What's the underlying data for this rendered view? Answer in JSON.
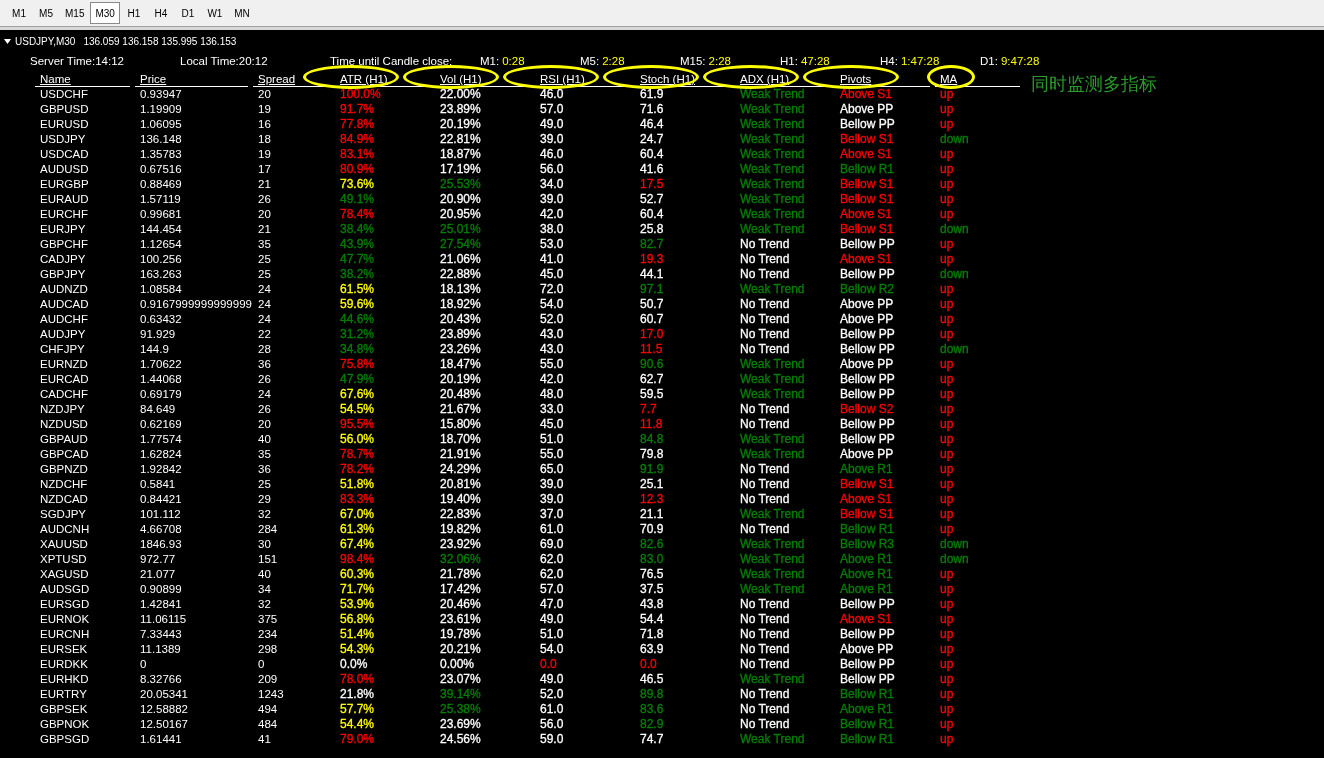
{
  "timeframes": [
    {
      "label": "M1",
      "selected": false
    },
    {
      "label": "M5",
      "selected": false
    },
    {
      "label": "M15",
      "selected": false
    },
    {
      "label": "M30",
      "selected": true
    },
    {
      "label": "H1",
      "selected": false
    },
    {
      "label": "H4",
      "selected": false
    },
    {
      "label": "D1",
      "selected": false
    },
    {
      "label": "W1",
      "selected": false
    },
    {
      "label": "MN",
      "selected": false
    }
  ],
  "chart_title": {
    "symbol": "USDJPY,M30",
    "quotes": "136.059 136.158 135.995 136.153"
  },
  "info": {
    "server_time": "Server Time:14:12",
    "local_time": "Local Time:20:12",
    "countdown_label": "Time until Candle close:",
    "countdowns": [
      {
        "label": "M1:",
        "value": "0:28"
      },
      {
        "label": "M5:",
        "value": "2:28"
      },
      {
        "label": "M15:",
        "value": "2:28"
      },
      {
        "label": "H1:",
        "value": "47:28"
      },
      {
        "label": "H4:",
        "value": "1:47:28"
      },
      {
        "label": "D1:",
        "value": "9:47:28"
      }
    ]
  },
  "columns": [
    {
      "label": "Name",
      "circled": false
    },
    {
      "label": "Price",
      "circled": false
    },
    {
      "label": "Spread",
      "circled": false
    },
    {
      "label": "ATR (H1)",
      "circled": true
    },
    {
      "label": "Vol (H1)",
      "circled": true
    },
    {
      "label": "RSI (H1)",
      "circled": true
    },
    {
      "label": "Stoch (H1)",
      "circled": true
    },
    {
      "label": "ADX (H1)",
      "circled": true
    },
    {
      "label": "Pivots",
      "circled": true
    },
    {
      "label": "MA",
      "circled": true
    }
  ],
  "annotation": "同时监测多指标",
  "rows": [
    {
      "symbol": "USDCHF",
      "price": "0.93947",
      "spread": "20",
      "cells": [
        {
          "text": "100.0%",
          "color": "#ff0000"
        },
        {
          "text": "22.00%",
          "color": "#ffffff"
        },
        {
          "text": "46.0",
          "color": "#ffffff"
        },
        {
          "text": "61.9",
          "color": "#ffffff"
        },
        {
          "text": "Weak Trend",
          "color": "#008000"
        },
        {
          "text": "Above S1",
          "color": "#ff0000"
        },
        {
          "text": "up",
          "color": "#ff0000"
        }
      ]
    },
    {
      "symbol": "GBPUSD",
      "price": "1.19909",
      "spread": "19",
      "cells": [
        {
          "text": "91.7%",
          "color": "#ff0000"
        },
        {
          "text": "23.89%",
          "color": "#ffffff"
        },
        {
          "text": "57.0",
          "color": "#ffffff"
        },
        {
          "text": "71.6",
          "color": "#ffffff"
        },
        {
          "text": "Weak Trend",
          "color": "#008000"
        },
        {
          "text": "Above PP",
          "color": "#ffffff"
        },
        {
          "text": "up",
          "color": "#ff0000"
        }
      ]
    },
    {
      "symbol": "EURUSD",
      "price": "1.06095",
      "spread": "16",
      "cells": [
        {
          "text": "77.8%",
          "color": "#ff0000"
        },
        {
          "text": "20.19%",
          "color": "#ffffff"
        },
        {
          "text": "49.0",
          "color": "#ffffff"
        },
        {
          "text": "46.4",
          "color": "#ffffff"
        },
        {
          "text": "Weak Trend",
          "color": "#008000"
        },
        {
          "text": "Bellow PP",
          "color": "#ffffff"
        },
        {
          "text": "up",
          "color": "#ff0000"
        }
      ]
    },
    {
      "symbol": "USDJPY",
      "price": "136.148",
      "spread": "18",
      "cells": [
        {
          "text": "84.9%",
          "color": "#ff0000"
        },
        {
          "text": "22.81%",
          "color": "#ffffff"
        },
        {
          "text": "39.0",
          "color": "#ffffff"
        },
        {
          "text": "24.7",
          "color": "#ffffff"
        },
        {
          "text": "Weak Trend",
          "color": "#008000"
        },
        {
          "text": "Bellow S1",
          "color": "#ff0000"
        },
        {
          "text": "down",
          "color": "#008000"
        }
      ]
    },
    {
      "symbol": "USDCAD",
      "price": "1.35783",
      "spread": "19",
      "cells": [
        {
          "text": "83.1%",
          "color": "#ff0000"
        },
        {
          "text": "18.87%",
          "color": "#ffffff"
        },
        {
          "text": "46.0",
          "color": "#ffffff"
        },
        {
          "text": "60.4",
          "color": "#ffffff"
        },
        {
          "text": "Weak Trend",
          "color": "#008000"
        },
        {
          "text": "Above S1",
          "color": "#ff0000"
        },
        {
          "text": "up",
          "color": "#ff0000"
        }
      ]
    },
    {
      "symbol": "AUDUSD",
      "price": "0.67516",
      "spread": "17",
      "cells": [
        {
          "text": "80.9%",
          "color": "#ff0000"
        },
        {
          "text": "17.19%",
          "color": "#ffffff"
        },
        {
          "text": "56.0",
          "color": "#ffffff"
        },
        {
          "text": "41.6",
          "color": "#ffffff"
        },
        {
          "text": "Weak Trend",
          "color": "#008000"
        },
        {
          "text": "Bellow R1",
          "color": "#008000"
        },
        {
          "text": "up",
          "color": "#ff0000"
        }
      ]
    },
    {
      "symbol": "EURGBP",
      "price": "0.88469",
      "spread": "21",
      "cells": [
        {
          "text": "73.6%",
          "color": "#ffff00"
        },
        {
          "text": "25.53%",
          "color": "#008000"
        },
        {
          "text": "34.0",
          "color": "#ffffff"
        },
        {
          "text": "17.5",
          "color": "#ff0000"
        },
        {
          "text": "Weak Trend",
          "color": "#008000"
        },
        {
          "text": "Bellow S1",
          "color": "#ff0000"
        },
        {
          "text": "up",
          "color": "#ff0000"
        }
      ]
    },
    {
      "symbol": "EURAUD",
      "price": "1.57119",
      "spread": "26",
      "cells": [
        {
          "text": "49.1%",
          "color": "#008000"
        },
        {
          "text": "20.90%",
          "color": "#ffffff"
        },
        {
          "text": "39.0",
          "color": "#ffffff"
        },
        {
          "text": "52.7",
          "color": "#ffffff"
        },
        {
          "text": "Weak Trend",
          "color": "#008000"
        },
        {
          "text": "Bellow S1",
          "color": "#ff0000"
        },
        {
          "text": "up",
          "color": "#ff0000"
        }
      ]
    },
    {
      "symbol": "EURCHF",
      "price": "0.99681",
      "spread": "20",
      "cells": [
        {
          "text": "78.4%",
          "color": "#ff0000"
        },
        {
          "text": "20.95%",
          "color": "#ffffff"
        },
        {
          "text": "42.0",
          "color": "#ffffff"
        },
        {
          "text": "60.4",
          "color": "#ffffff"
        },
        {
          "text": "Weak Trend",
          "color": "#008000"
        },
        {
          "text": "Above S1",
          "color": "#ff0000"
        },
        {
          "text": "up",
          "color": "#ff0000"
        }
      ]
    },
    {
      "symbol": "EURJPY",
      "price": "144.454",
      "spread": "21",
      "cells": [
        {
          "text": "38.4%",
          "color": "#008000"
        },
        {
          "text": "25.01%",
          "color": "#008000"
        },
        {
          "text": "38.0",
          "color": "#ffffff"
        },
        {
          "text": "25.8",
          "color": "#ffffff"
        },
        {
          "text": "Weak Trend",
          "color": "#008000"
        },
        {
          "text": "Bellow S1",
          "color": "#ff0000"
        },
        {
          "text": "down",
          "color": "#008000"
        }
      ]
    },
    {
      "symbol": "GBPCHF",
      "price": "1.12654",
      "spread": "35",
      "cells": [
        {
          "text": "43.9%",
          "color": "#008000"
        },
        {
          "text": "27.54%",
          "color": "#008000"
        },
        {
          "text": "53.0",
          "color": "#ffffff"
        },
        {
          "text": "82.7",
          "color": "#008000"
        },
        {
          "text": "No Trend",
          "color": "#ffffff"
        },
        {
          "text": "Bellow PP",
          "color": "#ffffff"
        },
        {
          "text": "up",
          "color": "#ff0000"
        }
      ]
    },
    {
      "symbol": "CADJPY",
      "price": "100.256",
      "spread": "25",
      "cells": [
        {
          "text": "47.7%",
          "color": "#008000"
        },
        {
          "text": "21.06%",
          "color": "#ffffff"
        },
        {
          "text": "41.0",
          "color": "#ffffff"
        },
        {
          "text": "19.3",
          "color": "#ff0000"
        },
        {
          "text": "No Trend",
          "color": "#ffffff"
        },
        {
          "text": "Above S1",
          "color": "#ff0000"
        },
        {
          "text": "up",
          "color": "#ff0000"
        }
      ]
    },
    {
      "symbol": "GBPJPY",
      "price": "163.263",
      "spread": "25",
      "cells": [
        {
          "text": "38.2%",
          "color": "#008000"
        },
        {
          "text": "22.88%",
          "color": "#ffffff"
        },
        {
          "text": "45.0",
          "color": "#ffffff"
        },
        {
          "text": "44.1",
          "color": "#ffffff"
        },
        {
          "text": "No Trend",
          "color": "#ffffff"
        },
        {
          "text": "Bellow PP",
          "color": "#ffffff"
        },
        {
          "text": "down",
          "color": "#008000"
        }
      ]
    },
    {
      "symbol": "AUDNZD",
      "price": "1.08584",
      "spread": "24",
      "cells": [
        {
          "text": "61.5%",
          "color": "#ffff00"
        },
        {
          "text": "18.13%",
          "color": "#ffffff"
        },
        {
          "text": "72.0",
          "color": "#ffffff"
        },
        {
          "text": "97.1",
          "color": "#008000"
        },
        {
          "text": "Weak Trend",
          "color": "#008000"
        },
        {
          "text": "Bellow R2",
          "color": "#008000"
        },
        {
          "text": "up",
          "color": "#ff0000"
        }
      ]
    },
    {
      "symbol": "AUDCAD",
      "price": "0.9167999999999999",
      "spread": "24",
      "cells": [
        {
          "text": "59.6%",
          "color": "#ffff00"
        },
        {
          "text": "18.92%",
          "color": "#ffffff"
        },
        {
          "text": "54.0",
          "color": "#ffffff"
        },
        {
          "text": "50.7",
          "color": "#ffffff"
        },
        {
          "text": "No Trend",
          "color": "#ffffff"
        },
        {
          "text": "Above PP",
          "color": "#ffffff"
        },
        {
          "text": "up",
          "color": "#ff0000"
        }
      ]
    },
    {
      "symbol": "AUDCHF",
      "price": "0.63432",
      "spread": "24",
      "cells": [
        {
          "text": "44.6%",
          "color": "#008000"
        },
        {
          "text": "20.43%",
          "color": "#ffffff"
        },
        {
          "text": "52.0",
          "color": "#ffffff"
        },
        {
          "text": "60.7",
          "color": "#ffffff"
        },
        {
          "text": "No Trend",
          "color": "#ffffff"
        },
        {
          "text": "Above PP",
          "color": "#ffffff"
        },
        {
          "text": "up",
          "color": "#ff0000"
        }
      ]
    },
    {
      "symbol": "AUDJPY",
      "price": "91.929",
      "spread": "22",
      "cells": [
        {
          "text": "31.2%",
          "color": "#008000"
        },
        {
          "text": "23.89%",
          "color": "#ffffff"
        },
        {
          "text": "43.0",
          "color": "#ffffff"
        },
        {
          "text": "17.0",
          "color": "#ff0000"
        },
        {
          "text": "No Trend",
          "color": "#ffffff"
        },
        {
          "text": "Bellow PP",
          "color": "#ffffff"
        },
        {
          "text": "up",
          "color": "#ff0000"
        }
      ]
    },
    {
      "symbol": "CHFJPY",
      "price": "144.9",
      "spread": "28",
      "cells": [
        {
          "text": "34.8%",
          "color": "#008000"
        },
        {
          "text": "23.26%",
          "color": "#ffffff"
        },
        {
          "text": "43.0",
          "color": "#ffffff"
        },
        {
          "text": "11.5",
          "color": "#ff0000"
        },
        {
          "text": "No Trend",
          "color": "#ffffff"
        },
        {
          "text": "Bellow PP",
          "color": "#ffffff"
        },
        {
          "text": "down",
          "color": "#008000"
        }
      ]
    },
    {
      "symbol": "EURNZD",
      "price": "1.70622",
      "spread": "36",
      "cells": [
        {
          "text": "75.8%",
          "color": "#ff0000"
        },
        {
          "text": "18.47%",
          "color": "#ffffff"
        },
        {
          "text": "55.0",
          "color": "#ffffff"
        },
        {
          "text": "90.6",
          "color": "#008000"
        },
        {
          "text": "Weak Trend",
          "color": "#008000"
        },
        {
          "text": "Above PP",
          "color": "#ffffff"
        },
        {
          "text": "up",
          "color": "#ff0000"
        }
      ]
    },
    {
      "symbol": "EURCAD",
      "price": "1.44068",
      "spread": "26",
      "cells": [
        {
          "text": "47.9%",
          "color": "#008000"
        },
        {
          "text": "20.19%",
          "color": "#ffffff"
        },
        {
          "text": "42.0",
          "color": "#ffffff"
        },
        {
          "text": "62.7",
          "color": "#ffffff"
        },
        {
          "text": "Weak Trend",
          "color": "#008000"
        },
        {
          "text": "Bellow PP",
          "color": "#ffffff"
        },
        {
          "text": "up",
          "color": "#ff0000"
        }
      ]
    },
    {
      "symbol": "CADCHF",
      "price": "0.69179",
      "spread": "24",
      "cells": [
        {
          "text": "67.6%",
          "color": "#ffff00"
        },
        {
          "text": "20.48%",
          "color": "#ffffff"
        },
        {
          "text": "48.0",
          "color": "#ffffff"
        },
        {
          "text": "59.5",
          "color": "#ffffff"
        },
        {
          "text": "Weak Trend",
          "color": "#008000"
        },
        {
          "text": "Bellow PP",
          "color": "#ffffff"
        },
        {
          "text": "up",
          "color": "#ff0000"
        }
      ]
    },
    {
      "symbol": "NZDJPY",
      "price": "84.649",
      "spread": "26",
      "cells": [
        {
          "text": "54.5%",
          "color": "#ffff00"
        },
        {
          "text": "21.67%",
          "color": "#ffffff"
        },
        {
          "text": "33.0",
          "color": "#ffffff"
        },
        {
          "text": "7.7",
          "color": "#ff0000"
        },
        {
          "text": "No Trend",
          "color": "#ffffff"
        },
        {
          "text": "Bellow S2",
          "color": "#ff0000"
        },
        {
          "text": "up",
          "color": "#ff0000"
        }
      ]
    },
    {
      "symbol": "NZDUSD",
      "price": "0.62169",
      "spread": "20",
      "cells": [
        {
          "text": "95.5%",
          "color": "#ff0000"
        },
        {
          "text": "15.80%",
          "color": "#ffffff"
        },
        {
          "text": "45.0",
          "color": "#ffffff"
        },
        {
          "text": "11.8",
          "color": "#ff0000"
        },
        {
          "text": "No Trend",
          "color": "#ffffff"
        },
        {
          "text": "Bellow PP",
          "color": "#ffffff"
        },
        {
          "text": "up",
          "color": "#ff0000"
        }
      ]
    },
    {
      "symbol": "GBPAUD",
      "price": "1.77574",
      "spread": "40",
      "cells": [
        {
          "text": "56.0%",
          "color": "#ffff00"
        },
        {
          "text": "18.70%",
          "color": "#ffffff"
        },
        {
          "text": "51.0",
          "color": "#ffffff"
        },
        {
          "text": "84.8",
          "color": "#008000"
        },
        {
          "text": "Weak Trend",
          "color": "#008000"
        },
        {
          "text": "Bellow PP",
          "color": "#ffffff"
        },
        {
          "text": "up",
          "color": "#ff0000"
        }
      ]
    },
    {
      "symbol": "GBPCAD",
      "price": "1.62824",
      "spread": "35",
      "cells": [
        {
          "text": "78.7%",
          "color": "#ff0000"
        },
        {
          "text": "21.91%",
          "color": "#ffffff"
        },
        {
          "text": "55.0",
          "color": "#ffffff"
        },
        {
          "text": "79.8",
          "color": "#ffffff"
        },
        {
          "text": "Weak Trend",
          "color": "#008000"
        },
        {
          "text": "Above PP",
          "color": "#ffffff"
        },
        {
          "text": "up",
          "color": "#ff0000"
        }
      ]
    },
    {
      "symbol": "GBPNZD",
      "price": "1.92842",
      "spread": "36",
      "cells": [
        {
          "text": "78.2%",
          "color": "#ff0000"
        },
        {
          "text": "24.29%",
          "color": "#ffffff"
        },
        {
          "text": "65.0",
          "color": "#ffffff"
        },
        {
          "text": "91.9",
          "color": "#008000"
        },
        {
          "text": "No Trend",
          "color": "#ffffff"
        },
        {
          "text": "Above R1",
          "color": "#008000"
        },
        {
          "text": "up",
          "color": "#ff0000"
        }
      ]
    },
    {
      "symbol": "NZDCHF",
      "price": "0.5841",
      "spread": "25",
      "cells": [
        {
          "text": "51.8%",
          "color": "#ffff00"
        },
        {
          "text": "20.81%",
          "color": "#ffffff"
        },
        {
          "text": "39.0",
          "color": "#ffffff"
        },
        {
          "text": "25.1",
          "color": "#ffffff"
        },
        {
          "text": "No Trend",
          "color": "#ffffff"
        },
        {
          "text": "Bellow S1",
          "color": "#ff0000"
        },
        {
          "text": "up",
          "color": "#ff0000"
        }
      ]
    },
    {
      "symbol": "NZDCAD",
      "price": "0.84421",
      "spread": "29",
      "cells": [
        {
          "text": "83.3%",
          "color": "#ff0000"
        },
        {
          "text": "19.40%",
          "color": "#ffffff"
        },
        {
          "text": "39.0",
          "color": "#ffffff"
        },
        {
          "text": "12.3",
          "color": "#ff0000"
        },
        {
          "text": "No Trend",
          "color": "#ffffff"
        },
        {
          "text": "Above S1",
          "color": "#ff0000"
        },
        {
          "text": "up",
          "color": "#ff0000"
        }
      ]
    },
    {
      "symbol": "SGDJPY",
      "price": "101.112",
      "spread": "32",
      "cells": [
        {
          "text": "67.0%",
          "color": "#ffff00"
        },
        {
          "text": "22.83%",
          "color": "#ffffff"
        },
        {
          "text": "37.0",
          "color": "#ffffff"
        },
        {
          "text": "21.1",
          "color": "#ffffff"
        },
        {
          "text": "Weak Trend",
          "color": "#008000"
        },
        {
          "text": "Bellow S1",
          "color": "#ff0000"
        },
        {
          "text": "up",
          "color": "#ff0000"
        }
      ]
    },
    {
      "symbol": "AUDCNH",
      "price": "4.66708",
      "spread": "284",
      "cells": [
        {
          "text": "61.3%",
          "color": "#ffff00"
        },
        {
          "text": "19.82%",
          "color": "#ffffff"
        },
        {
          "text": "61.0",
          "color": "#ffffff"
        },
        {
          "text": "70.9",
          "color": "#ffffff"
        },
        {
          "text": "No Trend",
          "color": "#ffffff"
        },
        {
          "text": "Bellow R1",
          "color": "#008000"
        },
        {
          "text": "up",
          "color": "#ff0000"
        }
      ]
    },
    {
      "symbol": "XAUUSD",
      "price": "1846.93",
      "spread": "30",
      "cells": [
        {
          "text": "67.4%",
          "color": "#ffff00"
        },
        {
          "text": "23.92%",
          "color": "#ffffff"
        },
        {
          "text": "69.0",
          "color": "#ffffff"
        },
        {
          "text": "82.6",
          "color": "#008000"
        },
        {
          "text": "Weak Trend",
          "color": "#008000"
        },
        {
          "text": "Bellow R3",
          "color": "#008000"
        },
        {
          "text": "down",
          "color": "#008000"
        }
      ]
    },
    {
      "symbol": "XPTUSD",
      "price": "972.77",
      "spread": "151",
      "cells": [
        {
          "text": "98.4%",
          "color": "#ff0000"
        },
        {
          "text": "32.06%",
          "color": "#008000"
        },
        {
          "text": "62.0",
          "color": "#ffffff"
        },
        {
          "text": "83.0",
          "color": "#008000"
        },
        {
          "text": "Weak Trend",
          "color": "#008000"
        },
        {
          "text": "Above R1",
          "color": "#008000"
        },
        {
          "text": "down",
          "color": "#008000"
        }
      ]
    },
    {
      "symbol": "XAGUSD",
      "price": "21.077",
      "spread": "40",
      "cells": [
        {
          "text": "60.3%",
          "color": "#ffff00"
        },
        {
          "text": "21.78%",
          "color": "#ffffff"
        },
        {
          "text": "62.0",
          "color": "#ffffff"
        },
        {
          "text": "76.5",
          "color": "#ffffff"
        },
        {
          "text": "Weak Trend",
          "color": "#008000"
        },
        {
          "text": "Above R1",
          "color": "#008000"
        },
        {
          "text": "up",
          "color": "#ff0000"
        }
      ]
    },
    {
      "symbol": "AUDSGD",
      "price": "0.90899",
      "spread": "34",
      "cells": [
        {
          "text": "71.7%",
          "color": "#ffff00"
        },
        {
          "text": "17.42%",
          "color": "#ffffff"
        },
        {
          "text": "57.0",
          "color": "#ffffff"
        },
        {
          "text": "37.5",
          "color": "#ffffff"
        },
        {
          "text": "Weak Trend",
          "color": "#008000"
        },
        {
          "text": "Above R1",
          "color": "#008000"
        },
        {
          "text": "up",
          "color": "#ff0000"
        }
      ]
    },
    {
      "symbol": "EURSGD",
      "price": "1.42841",
      "spread": "32",
      "cells": [
        {
          "text": "53.9%",
          "color": "#ffff00"
        },
        {
          "text": "20.46%",
          "color": "#ffffff"
        },
        {
          "text": "47.0",
          "color": "#ffffff"
        },
        {
          "text": "43.8",
          "color": "#ffffff"
        },
        {
          "text": "No Trend",
          "color": "#ffffff"
        },
        {
          "text": "Bellow PP",
          "color": "#ffffff"
        },
        {
          "text": "up",
          "color": "#ff0000"
        }
      ]
    },
    {
      "symbol": "EURNOK",
      "price": "11.06115",
      "spread": "375",
      "cells": [
        {
          "text": "56.8%",
          "color": "#ffff00"
        },
        {
          "text": "23.61%",
          "color": "#ffffff"
        },
        {
          "text": "49.0",
          "color": "#ffffff"
        },
        {
          "text": "54.4",
          "color": "#ffffff"
        },
        {
          "text": "No Trend",
          "color": "#ffffff"
        },
        {
          "text": "Above S1",
          "color": "#ff0000"
        },
        {
          "text": "up",
          "color": "#ff0000"
        }
      ]
    },
    {
      "symbol": "EURCNH",
      "price": "7.33443",
      "spread": "234",
      "cells": [
        {
          "text": "51.4%",
          "color": "#ffff00"
        },
        {
          "text": "19.78%",
          "color": "#ffffff"
        },
        {
          "text": "51.0",
          "color": "#ffffff"
        },
        {
          "text": "71.8",
          "color": "#ffffff"
        },
        {
          "text": "No Trend",
          "color": "#ffffff"
        },
        {
          "text": "Bellow PP",
          "color": "#ffffff"
        },
        {
          "text": "up",
          "color": "#ff0000"
        }
      ]
    },
    {
      "symbol": "EURSEK",
      "price": "11.1389",
      "spread": "298",
      "cells": [
        {
          "text": "54.3%",
          "color": "#ffff00"
        },
        {
          "text": "20.21%",
          "color": "#ffffff"
        },
        {
          "text": "54.0",
          "color": "#ffffff"
        },
        {
          "text": "63.9",
          "color": "#ffffff"
        },
        {
          "text": "No Trend",
          "color": "#ffffff"
        },
        {
          "text": "Above PP",
          "color": "#ffffff"
        },
        {
          "text": "up",
          "color": "#ff0000"
        }
      ]
    },
    {
      "symbol": "EURDKK",
      "price": "0",
      "spread": "0",
      "cells": [
        {
          "text": "0.0%",
          "color": "#ffffff"
        },
        {
          "text": "0.00%",
          "color": "#ffffff"
        },
        {
          "text": "0.0",
          "color": "#ff0000"
        },
        {
          "text": "0.0",
          "color": "#ff0000"
        },
        {
          "text": "No Trend",
          "color": "#ffffff"
        },
        {
          "text": "Bellow PP",
          "color": "#ffffff"
        },
        {
          "text": "up",
          "color": "#ff0000"
        }
      ]
    },
    {
      "symbol": "EURHKD",
      "price": "8.32766",
      "spread": "209",
      "cells": [
        {
          "text": "78.0%",
          "color": "#ff0000"
        },
        {
          "text": "23.07%",
          "color": "#ffffff"
        },
        {
          "text": "49.0",
          "color": "#ffffff"
        },
        {
          "text": "46.5",
          "color": "#ffffff"
        },
        {
          "text": "Weak Trend",
          "color": "#008000"
        },
        {
          "text": "Bellow PP",
          "color": "#ffffff"
        },
        {
          "text": "up",
          "color": "#ff0000"
        }
      ]
    },
    {
      "symbol": "EURTRY",
      "price": "20.05341",
      "spread": "1243",
      "cells": [
        {
          "text": "21.8%",
          "color": "#ffffff"
        },
        {
          "text": "39.14%",
          "color": "#008000"
        },
        {
          "text": "52.0",
          "color": "#ffffff"
        },
        {
          "text": "89.8",
          "color": "#008000"
        },
        {
          "text": "No Trend",
          "color": "#ffffff"
        },
        {
          "text": "Bellow R1",
          "color": "#008000"
        },
        {
          "text": "up",
          "color": "#ff0000"
        }
      ]
    },
    {
      "symbol": "GBPSEK",
      "price": "12.58882",
      "spread": "494",
      "cells": [
        {
          "text": "57.7%",
          "color": "#ffff00"
        },
        {
          "text": "25.38%",
          "color": "#008000"
        },
        {
          "text": "61.0",
          "color": "#ffffff"
        },
        {
          "text": "83.6",
          "color": "#008000"
        },
        {
          "text": "No Trend",
          "color": "#ffffff"
        },
        {
          "text": "Above R1",
          "color": "#008000"
        },
        {
          "text": "up",
          "color": "#ff0000"
        }
      ]
    },
    {
      "symbol": "GBPNOK",
      "price": "12.50167",
      "spread": "484",
      "cells": [
        {
          "text": "54.4%",
          "color": "#ffff00"
        },
        {
          "text": "23.69%",
          "color": "#ffffff"
        },
        {
          "text": "56.0",
          "color": "#ffffff"
        },
        {
          "text": "82.9",
          "color": "#008000"
        },
        {
          "text": "No Trend",
          "color": "#ffffff"
        },
        {
          "text": "Bellow R1",
          "color": "#008000"
        },
        {
          "text": "up",
          "color": "#ff0000"
        }
      ]
    },
    {
      "symbol": "GBPSGD",
      "price": "1.61441",
      "spread": "41",
      "cells": [
        {
          "text": "79.0%",
          "color": "#ff0000"
        },
        {
          "text": "24.56%",
          "color": "#ffffff"
        },
        {
          "text": "59.0",
          "color": "#ffffff"
        },
        {
          "text": "74.7",
          "color": "#ffffff"
        },
        {
          "text": "Weak Trend",
          "color": "#008000"
        },
        {
          "text": "Bellow R1",
          "color": "#008000"
        },
        {
          "text": "up",
          "color": "#ff0000"
        }
      ]
    }
  ]
}
